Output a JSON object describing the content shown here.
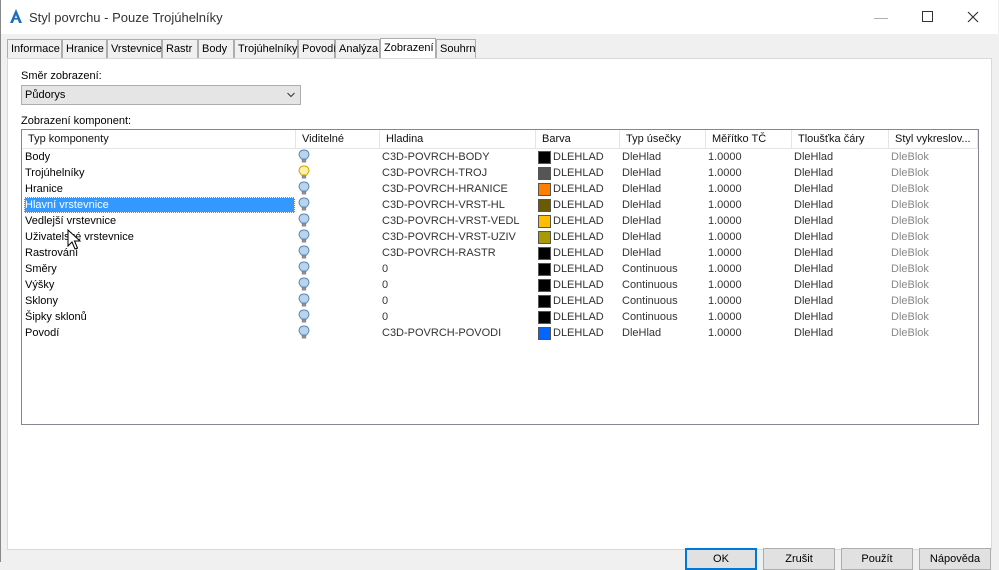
{
  "window": {
    "title": "Styl povrchu - Pouze Trojúhelníky",
    "minimize_icon": "minimize-icon",
    "maximize_icon": "maximize-icon",
    "close_icon": "close-icon"
  },
  "tabs": [
    {
      "label": "Informace"
    },
    {
      "label": "Hranice"
    },
    {
      "label": "Vrstevnice"
    },
    {
      "label": "Rastr"
    },
    {
      "label": "Body"
    },
    {
      "label": "Trojúhelníky"
    },
    {
      "label": "Povodí"
    },
    {
      "label": "Analýza"
    },
    {
      "label": "Zobrazení",
      "active": true
    },
    {
      "label": "Souhrn"
    }
  ],
  "view_direction": {
    "label": "Směr zobrazení:",
    "value": "Půdorys"
  },
  "components": {
    "label": "Zobrazení komponent:",
    "columns": [
      "Typ komponenty",
      "Viditelné",
      "Hladina",
      "Barva",
      "Typ úsečky",
      "Měřítko TČ",
      "Tloušťka čáry",
      "Styl vykreslov..."
    ],
    "rows": [
      {
        "name": "Body",
        "visible": "on",
        "layer": "C3D-POVRCH-BODY",
        "color": "#000000",
        "color_label": "DLEHLAD",
        "linetype": "DleHlad",
        "scale": "1.0000",
        "lineweight": "DleHlad",
        "plotstyle": "DleBlok"
      },
      {
        "name": "Trojúhelníky",
        "visible": "lit",
        "layer": "C3D-POVRCH-TROJ",
        "color": "#555555",
        "color_label": "DLEHLAD",
        "linetype": "DleHlad",
        "scale": "1.0000",
        "lineweight": "DleHlad",
        "plotstyle": "DleBlok"
      },
      {
        "name": "Hranice",
        "visible": "on",
        "layer": "C3D-POVRCH-HRANICE",
        "color": "#ff7f00",
        "color_label": "DLEHLAD",
        "linetype": "DleHlad",
        "scale": "1.0000",
        "lineweight": "DleHlad",
        "plotstyle": "DleBlok"
      },
      {
        "name": "Hlavní vrstevnice",
        "visible": "on",
        "layer": "C3D-POVRCH-VRST-HL",
        "color": "#6b5a00",
        "color_label": "DLEHLAD",
        "linetype": "DleHlad",
        "scale": "1.0000",
        "lineweight": "DleHlad",
        "plotstyle": "DleBlok",
        "selected": true
      },
      {
        "name": "Vedlejší vrstevnice",
        "visible": "on",
        "layer": "C3D-POVRCH-VRST-VEDL",
        "color": "#ffbf00",
        "color_label": "DLEHLAD",
        "linetype": "DleHlad",
        "scale": "1.0000",
        "lineweight": "DleHlad",
        "plotstyle": "DleBlok"
      },
      {
        "name": "Uživatelské vrstevnice",
        "visible": "on",
        "layer": "C3D-POVRCH-VRST-UZIV",
        "color": "#a89a00",
        "color_label": "DLEHLAD",
        "linetype": "DleHlad",
        "scale": "1.0000",
        "lineweight": "DleHlad",
        "plotstyle": "DleBlok"
      },
      {
        "name": "Rastrování",
        "visible": "on",
        "layer": "C3D-POVRCH-RASTR",
        "color": "#000000",
        "color_label": "DLEHLAD",
        "linetype": "DleHlad",
        "scale": "1.0000",
        "lineweight": "DleHlad",
        "plotstyle": "DleBlok"
      },
      {
        "name": "Směry",
        "visible": "on",
        "layer": "0",
        "color": "#000000",
        "color_label": "DLEHLAD",
        "linetype": "Continuous",
        "scale": "1.0000",
        "lineweight": "DleHlad",
        "plotstyle": "DleBlok"
      },
      {
        "name": "Výšky",
        "visible": "on",
        "layer": "0",
        "color": "#000000",
        "color_label": "DLEHLAD",
        "linetype": "Continuous",
        "scale": "1.0000",
        "lineweight": "DleHlad",
        "plotstyle": "DleBlok"
      },
      {
        "name": "Sklony",
        "visible": "on",
        "layer": "0",
        "color": "#000000",
        "color_label": "DLEHLAD",
        "linetype": "Continuous",
        "scale": "1.0000",
        "lineweight": "DleHlad",
        "plotstyle": "DleBlok"
      },
      {
        "name": "Šipky sklonů",
        "visible": "on",
        "layer": "0",
        "color": "#000000",
        "color_label": "DLEHLAD",
        "linetype": "Continuous",
        "scale": "1.0000",
        "lineweight": "DleHlad",
        "plotstyle": "DleBlok"
      },
      {
        "name": "Povodí",
        "visible": "on",
        "layer": "C3D-POVRCH-POVODI",
        "color": "#0066ff",
        "color_label": "DLEHLAD",
        "linetype": "DleHlad",
        "scale": "1.0000",
        "lineweight": "DleHlad",
        "plotstyle": "DleBlok"
      }
    ]
  },
  "buttons": {
    "ok": "OK",
    "cancel": "Zrušit",
    "apply": "Použít",
    "help": "Nápověda"
  },
  "icons": {
    "app": "autocad-civil-icon",
    "visible_on": "lightbulb-on-icon",
    "visible_lit": "lightbulb-lit-icon"
  }
}
